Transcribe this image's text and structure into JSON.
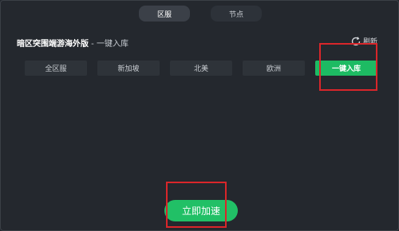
{
  "tabs": [
    {
      "label": "区服",
      "active": true
    },
    {
      "label": "节点",
      "active": false
    }
  ],
  "header": {
    "game_name": "暗区突围端游海外版",
    "separator_text": " - 一键入库"
  },
  "refresh": {
    "label": "刷新",
    "icon": "refresh-icon"
  },
  "regions": [
    {
      "label": "全区服",
      "selected": false
    },
    {
      "label": "新加坡",
      "selected": false
    },
    {
      "label": "北美",
      "selected": false
    },
    {
      "label": "欧洲",
      "selected": false
    },
    {
      "label": "一键入库",
      "selected": true
    }
  ],
  "start_button": {
    "label": "立即加速"
  },
  "colors": {
    "background": "#24282e",
    "accent_green": "#1dbb63",
    "annotation_red": "#d9262a",
    "button_bg": "#2e3339"
  }
}
